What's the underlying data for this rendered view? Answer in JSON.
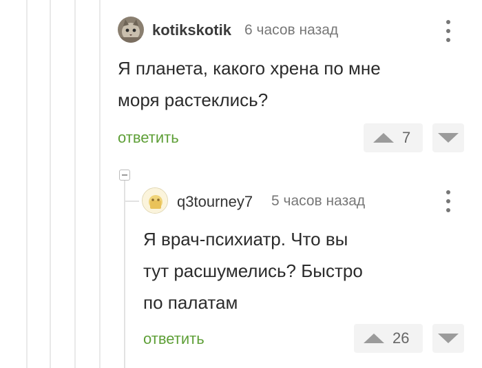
{
  "comment": {
    "username": "kotikskotik",
    "time_ago": "6 часов назад",
    "text_line1": "Я планета, какого хрена по мне",
    "text_line2": "моря растеклись?",
    "reply_label": "ответить",
    "votes": "7"
  },
  "reply": {
    "username": "q3tourney7",
    "time_ago": "5 часов назад",
    "text_line1": "Я врач-психиатр. Что вы",
    "text_line2": "тут расшумелись? Быстро",
    "text_line3": "по палатам",
    "reply_label": "ответить",
    "votes": "26"
  },
  "colors": {
    "reply_link": "#5e9f37",
    "vote_icon": "#9b9b9b",
    "thread_line": "#e9e9e9"
  },
  "icons": {
    "menu": "kebab-menu-icon",
    "upvote": "triangle-up-icon",
    "downvote": "triangle-down-icon",
    "collapse": "minus-square-icon"
  }
}
